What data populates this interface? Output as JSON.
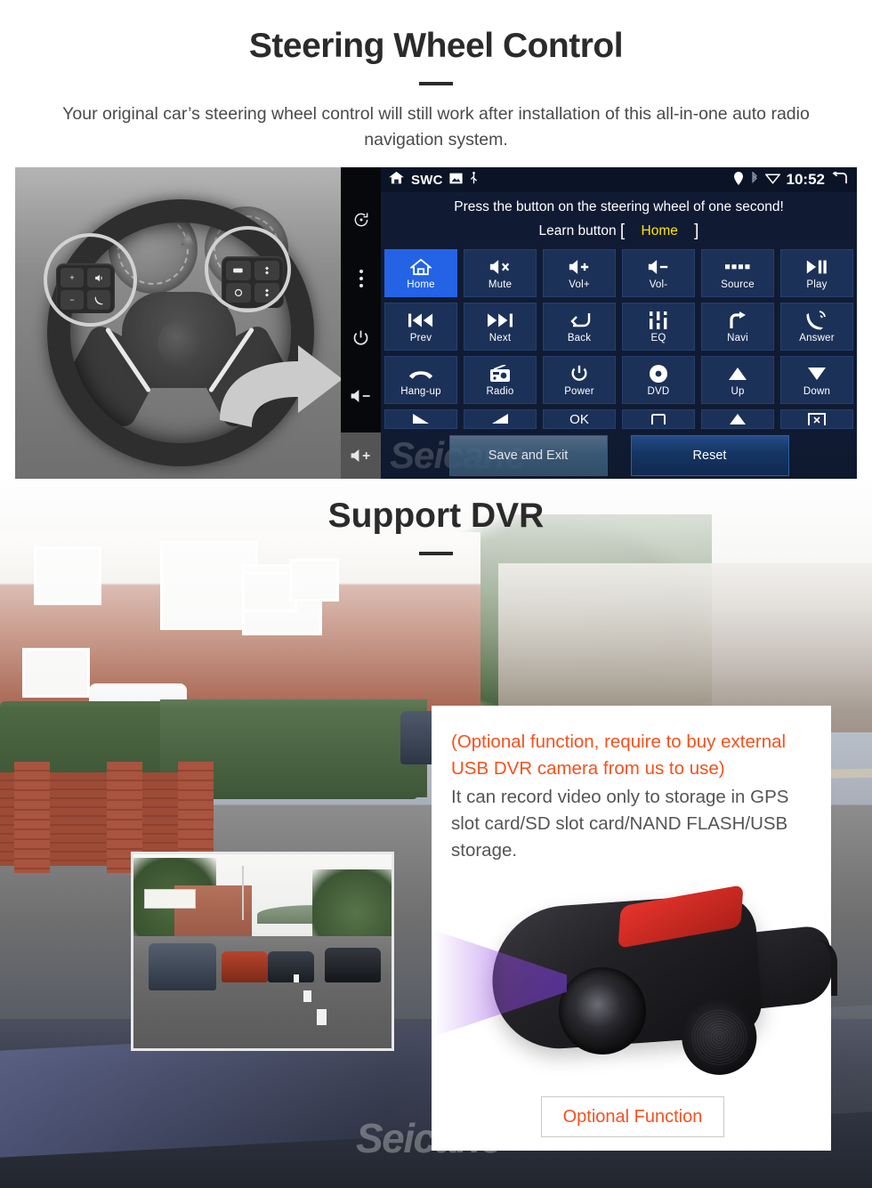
{
  "sections": [
    {
      "id": "steering-wheel-control",
      "title": "Steering Wheel Control",
      "subtitle": "Your original car’s steering wheel control will still work after installation of this all-in-one auto radio navigation system."
    },
    {
      "id": "support-dvr",
      "title": "Support DVR"
    }
  ],
  "head_unit": {
    "status_bar": {
      "home_icon": "home-icon",
      "app_label": "SWC",
      "picture_icon": "picture-icon",
      "usb_icon": "usb-icon",
      "gps_icon": "location-pin-icon",
      "bluetooth_icon": "bluetooth-icon",
      "wifi_icon": "wifi-icon",
      "clock": "10:52",
      "back_icon": "back-arrow-icon"
    },
    "side_bar": [
      {
        "name": "rotate-screen-icon",
        "label": "rotate"
      },
      {
        "name": "more-options-icon",
        "label": "more"
      },
      {
        "name": "power-icon",
        "label": "power"
      },
      {
        "name": "volume-down-icon",
        "label": "volume down"
      },
      {
        "name": "volume-up-icon",
        "label": "volume up"
      }
    ],
    "instruction": "Press the button on the steering wheel of one second!",
    "learn": {
      "label": "Learn button",
      "bracket_open": "[",
      "value": "Home",
      "bracket_close": "]"
    },
    "buttons": [
      {
        "label": "Home",
        "icon": "home-icon",
        "selected": true
      },
      {
        "label": "Mute",
        "icon": "mute-icon",
        "selected": false
      },
      {
        "label": "Vol+",
        "icon": "volume-up-icon",
        "selected": false
      },
      {
        "label": "Vol-",
        "icon": "volume-down-icon",
        "selected": false
      },
      {
        "label": "Source",
        "icon": "source-icon",
        "selected": false
      },
      {
        "label": "Play",
        "icon": "play-pause-icon",
        "selected": false
      },
      {
        "label": "Prev",
        "icon": "previous-track-icon",
        "selected": false
      },
      {
        "label": "Next",
        "icon": "next-track-icon",
        "selected": false
      },
      {
        "label": "Back",
        "icon": "back-icon",
        "selected": false
      },
      {
        "label": "EQ",
        "icon": "equalizer-icon",
        "selected": false
      },
      {
        "label": "Navi",
        "icon": "navigation-arrow-icon",
        "selected": false
      },
      {
        "label": "Answer",
        "icon": "answer-call-icon",
        "selected": false
      },
      {
        "label": "Hang-up",
        "icon": "hang-up-icon",
        "selected": false
      },
      {
        "label": "Radio",
        "icon": "radio-icon",
        "selected": false
      },
      {
        "label": "Power",
        "icon": "power-icon",
        "selected": false
      },
      {
        "label": "DVD",
        "icon": "disc-icon",
        "selected": false
      },
      {
        "label": "Up",
        "icon": "triangle-up-icon",
        "selected": false
      },
      {
        "label": "Down",
        "icon": "triangle-down-icon",
        "selected": false
      }
    ],
    "partial_row": [
      {
        "icon": "triangle-left-icon"
      },
      {
        "icon": "triangle-right-icon"
      },
      {
        "icon": "ok-icon"
      },
      {
        "icon": "square-icon"
      },
      {
        "icon": "triangle-up-icon"
      },
      {
        "icon": "close-box-icon"
      }
    ],
    "footer_buttons": [
      {
        "label": "Save and Exit",
        "name": "save-and-exit-button"
      },
      {
        "label": "Reset",
        "name": "reset-button"
      }
    ]
  },
  "dvr": {
    "warning_text": "(Optional function, require to buy external USB DVR camera from us to use)",
    "body_text": "It can record video only to storage in GPS slot card/SD slot card/NAND FLASH/USB storage.",
    "optional_button_label": "Optional Function"
  },
  "watermarks": {
    "brand": "Seicane"
  },
  "colors": {
    "selected_button": "#2463e6",
    "unselected_button": "#1c3158",
    "screen_background": "#101b33",
    "accent_orange": "#f4511e",
    "highlight_yellow": "#ffd52e",
    "learn_value_yellow": "#ffe400",
    "heading_dark": "#2b2b2b"
  }
}
